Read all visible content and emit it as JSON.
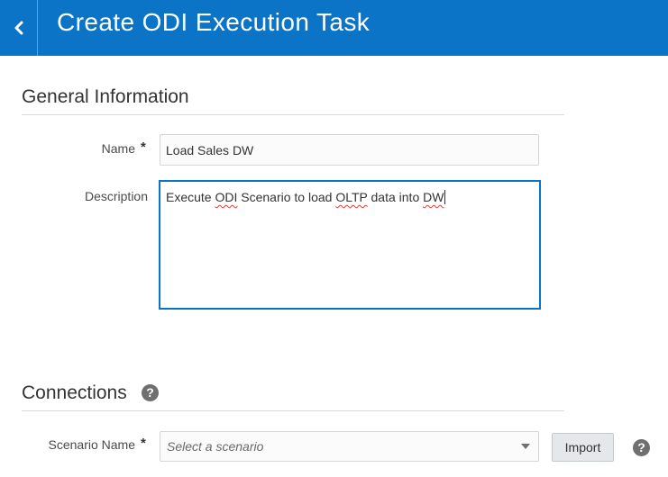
{
  "header": {
    "title": "Create ODI Execution Task",
    "back_icon": "chevron-left-icon",
    "background_color": "#0b74c7"
  },
  "general_information": {
    "title": "General Information",
    "name_label": "Name",
    "name_required_mark": "*",
    "name_value": "Load Sales DW",
    "description_label": "Description",
    "description_value": {
      "part1": "Execute ",
      "part2": "ODI",
      "part3": " Scenario to load ",
      "part4": "OLTP",
      "part5": " data into ",
      "part6": "DW"
    }
  },
  "connections": {
    "title": "Connections",
    "title_help_icon": "question-circle-icon",
    "scenario_label": "Scenario Name",
    "scenario_required_mark": "*",
    "scenario_placeholder": "Select a scenario",
    "import_label": "Import",
    "help_icon": "question-circle-icon"
  }
}
